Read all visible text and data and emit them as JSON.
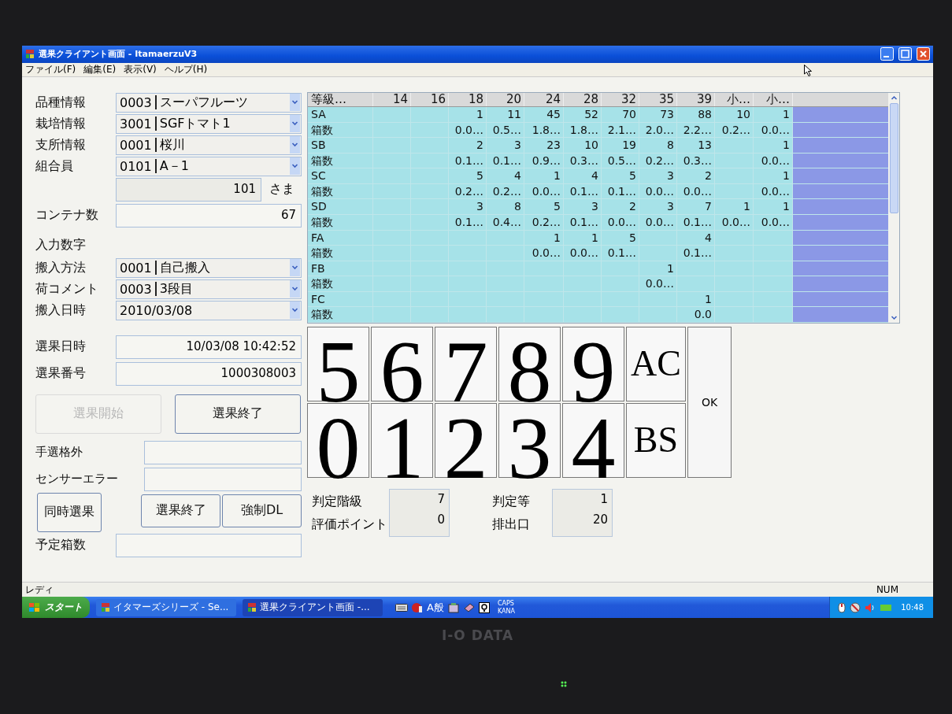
{
  "monitor": {
    "brand": "I-O DATA"
  },
  "window": {
    "title": "選果クライアント画面 - ItamaerzuV3"
  },
  "menu": [
    "ファイル(F)",
    "編集(E)",
    "表示(V)",
    "ヘルプ(H)"
  ],
  "form": [
    {
      "kind": "select",
      "label": "品種情報",
      "code": "0003",
      "value": "スーパフルーツ"
    },
    {
      "kind": "select",
      "label": "栽培情報",
      "code": "3001",
      "value": "SGFトマト1"
    },
    {
      "kind": "select",
      "label": "支所情報",
      "code": "0001",
      "value": "桜川"
    },
    {
      "kind": "select",
      "label": "組合員",
      "code": "0101",
      "value": "A－1"
    },
    {
      "kind": "suffix",
      "value": "101",
      "suffix": "さま"
    },
    {
      "kind": "text",
      "label": "コンテナ数",
      "value": "67"
    },
    {
      "kind": "heading",
      "label": "入力数字"
    },
    {
      "kind": "select",
      "label": "搬入方法",
      "code": "0001",
      "value": "自己搬入"
    },
    {
      "kind": "select",
      "label": "荷コメント",
      "code": "0003",
      "value": "3段目"
    },
    {
      "kind": "select",
      "label": "搬入日時",
      "value": "2010/03/08"
    },
    {
      "kind": "text",
      "label": "選果日時",
      "value": "10/03/08 10:42:52"
    },
    {
      "kind": "text",
      "label": "選果番号",
      "value": "1000308003"
    },
    {
      "kind": "buttons",
      "buttons": [
        {
          "label": "選果開始",
          "disabled": true
        },
        {
          "label": "選果終了",
          "disabled": false
        }
      ]
    },
    {
      "kind": "text",
      "label": "手選格外"
    },
    {
      "kind": "text",
      "label": "センサーエラー"
    },
    {
      "kind": "actions",
      "buttons": [
        {
          "label": "同時選果",
          "disabled": false
        },
        {
          "label": "選果終了",
          "disabled": false
        },
        {
          "label": "強制DL",
          "disabled": false
        }
      ]
    },
    {
      "kind": "text",
      "label": "予定箱数"
    }
  ],
  "table": {
    "columns": [
      "等級…",
      "14",
      "16",
      "18",
      "20",
      "24",
      "28",
      "32",
      "35",
      "39",
      "小…",
      "小…"
    ],
    "rows": [
      {
        "cells": [
          "SA",
          null,
          null,
          "1",
          "11",
          "45",
          "52",
          "70",
          "73",
          "88",
          "10",
          "1"
        ]
      },
      {
        "cells": [
          "箱数",
          null,
          null,
          "0.0…",
          "0.5…",
          "1.8…",
          "1.8…",
          "2.1…",
          "2.0…",
          "2.2…",
          "0.2…",
          "0.0…"
        ]
      },
      {
        "cells": [
          "SB",
          null,
          null,
          "2",
          "3",
          "23",
          "10",
          "19",
          "8",
          "13",
          null,
          "1"
        ]
      },
      {
        "cells": [
          "箱数",
          null,
          null,
          "0.1…",
          "0.1…",
          "0.9…",
          "0.3…",
          "0.5…",
          "0.2…",
          "0.3…",
          null,
          "0.0…"
        ]
      },
      {
        "cells": [
          "SC",
          null,
          null,
          "5",
          "4",
          "1",
          "4",
          "5",
          "3",
          "2",
          null,
          "1"
        ]
      },
      {
        "cells": [
          "箱数",
          null,
          null,
          "0.2…",
          "0.2…",
          "0.0…",
          "0.1…",
          "0.1…",
          "0.0…",
          "0.0…",
          null,
          "0.0…"
        ]
      },
      {
        "cells": [
          "SD",
          null,
          null,
          "3",
          "8",
          "5",
          "3",
          "2",
          "3",
          "7",
          "1",
          "1"
        ]
      },
      {
        "cells": [
          "箱数",
          null,
          null,
          "0.1…",
          "0.4…",
          "0.2…",
          "0.1…",
          "0.0…",
          "0.0…",
          "0.1…",
          "0.0…",
          "0.0…"
        ]
      },
      {
        "cells": [
          "FA",
          null,
          null,
          null,
          null,
          "1",
          "1",
          "5",
          null,
          "4",
          null,
          null
        ]
      },
      {
        "cells": [
          "箱数",
          null,
          null,
          null,
          null,
          "0.0…",
          "0.0…",
          "0.1…",
          null,
          "0.1…",
          null,
          null
        ]
      },
      {
        "cells": [
          "FB",
          null,
          null,
          null,
          null,
          null,
          null,
          null,
          "1",
          null,
          null,
          null
        ]
      },
      {
        "cells": [
          "箱数",
          null,
          null,
          null,
          null,
          null,
          null,
          null,
          "0.0…",
          null,
          null,
          null
        ]
      },
      {
        "cells": [
          "FC",
          null,
          null,
          null,
          null,
          null,
          null,
          null,
          null,
          "1",
          null,
          null
        ]
      },
      {
        "cells": [
          "箱数",
          null,
          null,
          null,
          null,
          null,
          null,
          null,
          null,
          "0.0",
          null,
          null
        ]
      }
    ]
  },
  "keypad": {
    "rows": [
      [
        "5",
        "6",
        "7",
        "8",
        "9",
        "AC"
      ],
      [
        "0",
        "1",
        "2",
        "3",
        "4",
        "BS"
      ]
    ],
    "ok": "OK"
  },
  "results": [
    {
      "labels": [
        "判定階級",
        "評価ポイント"
      ],
      "values": [
        "7",
        "0"
      ]
    },
    {
      "labels": [
        "判定等",
        "排出口"
      ],
      "values": [
        "1",
        "20"
      ]
    }
  ],
  "status_bar": {
    "left": "レディ",
    "right": "NUM"
  },
  "taskbar": {
    "start": "スタート",
    "tasks": [
      {
        "label": "イタマーズシリーズ - Se...",
        "selected": false
      },
      {
        "label": "選果クライアント画面 -...",
        "selected": true
      }
    ],
    "ime": "A般",
    "caps": "CAPS",
    "kana": "KANA",
    "clock": "10:48"
  }
}
